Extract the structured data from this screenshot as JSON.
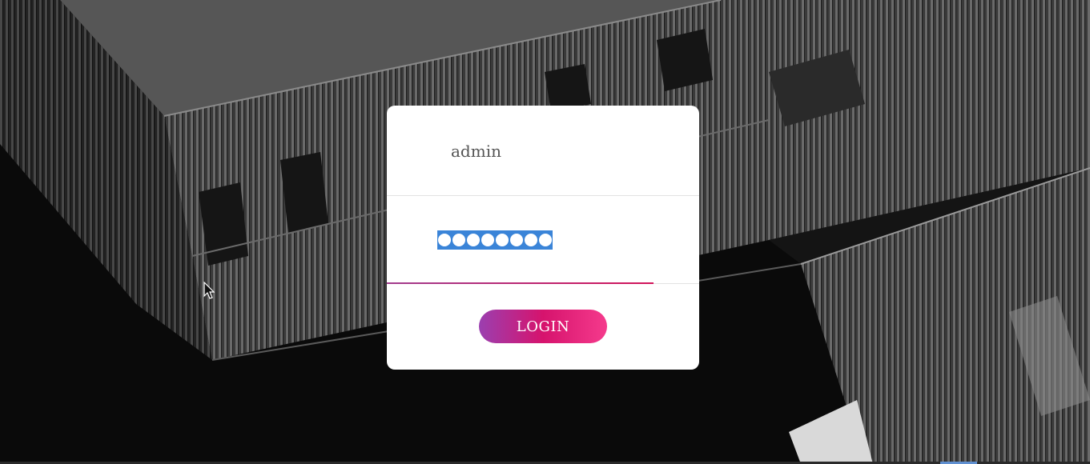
{
  "login_form": {
    "username_value": "admin",
    "password_masked_length": 8,
    "login_label": "LOGIN"
  },
  "colors": {
    "button_gradient_start": "#9b3fb0",
    "button_gradient_mid": "#d6136d",
    "button_gradient_end": "#f53a8c",
    "selection": "#3a84d8",
    "card": "#ffffff"
  },
  "icons": {
    "cursor": "mouse-pointer-icon"
  }
}
